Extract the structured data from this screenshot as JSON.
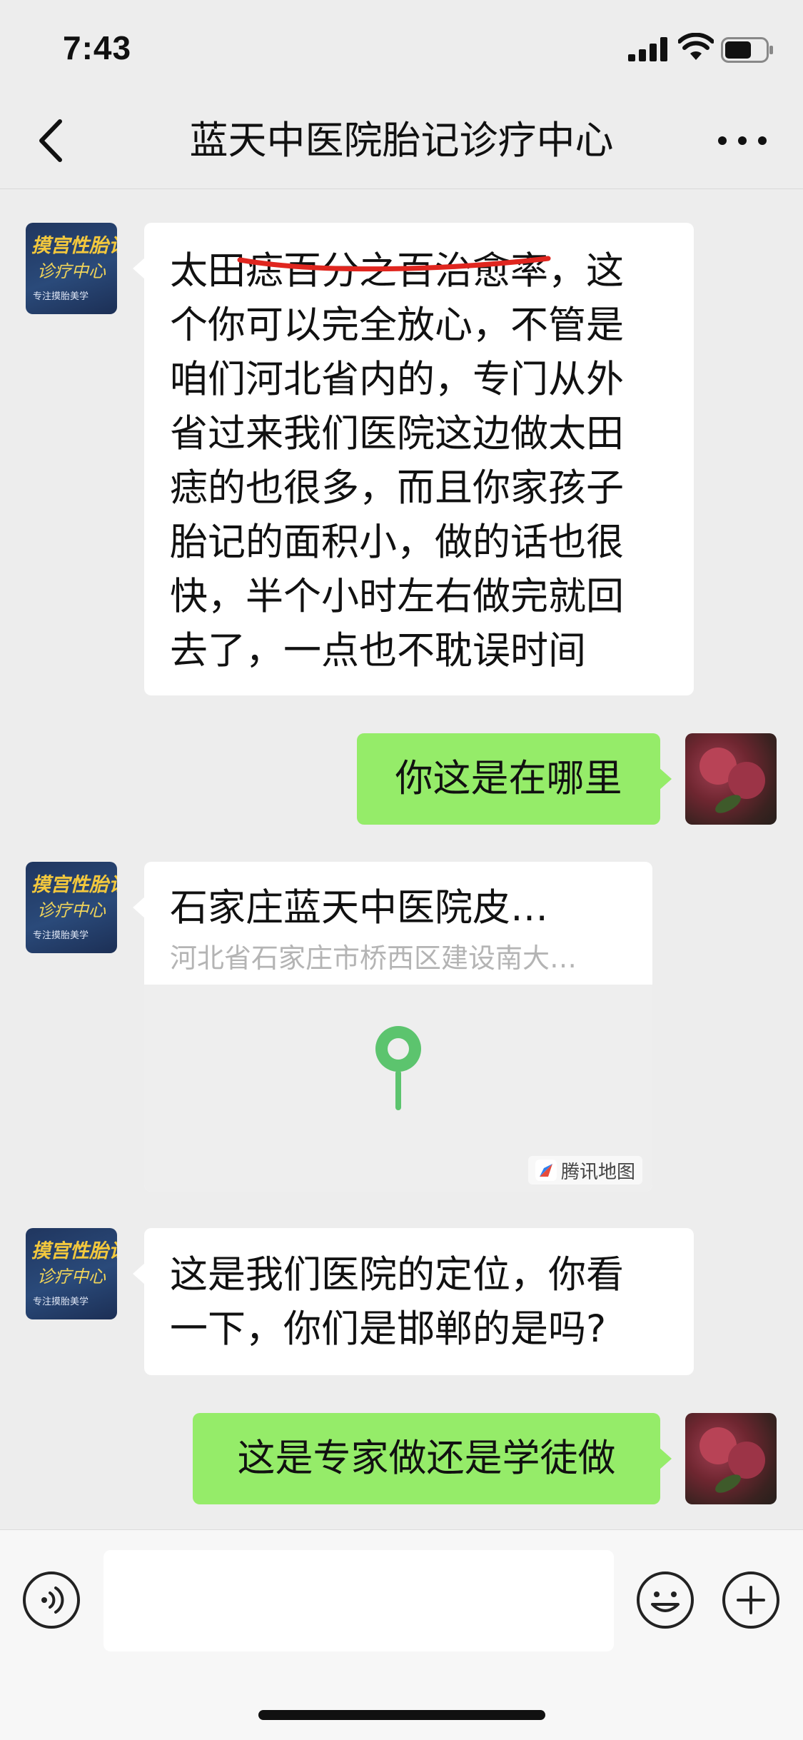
{
  "status_bar": {
    "time": "7:43"
  },
  "nav": {
    "title": "蓝天中医院胎记诊疗中心"
  },
  "contact_avatar": {
    "line1": "摸宫性胎记",
    "line2": "诊疗中心",
    "line3": "专注摸胎美学"
  },
  "messages": [
    {
      "sender": "contact",
      "type": "text",
      "text": "太田痣百分之百治愈率，这\n个你可以完全放心，不管是\n咱们河北省内的，专门从外\n省过来我们医院这边做太田\n痣的也很多，而且你家孩子\n胎记的面积小，做的话也很\n快，半个小时左右做完就回\n去了，一点也不耽误时间"
    },
    {
      "sender": "me",
      "type": "text",
      "text": "你这是在哪里"
    },
    {
      "sender": "contact",
      "type": "location",
      "name": "石家庄蓝天中医院皮…",
      "address": "河北省石家庄市桥西区建设南大…",
      "map_provider": "腾讯地图"
    },
    {
      "sender": "contact",
      "type": "text",
      "text": "这是我们医院的定位，你看\n一下，你们是邯郸的是吗?"
    },
    {
      "sender": "me",
      "type": "text",
      "text": "这是专家做还是学徒做"
    }
  ],
  "input_bar": {
    "placeholder": ""
  },
  "colors": {
    "background": "#ededed",
    "outgoing_bubble": "#95ec69",
    "incoming_bubble": "#ffffff",
    "map_pin": "#5cc46e",
    "annotation": "#e0261f"
  },
  "icons": [
    "signal-icon",
    "wifi-icon",
    "battery-icon",
    "back-icon",
    "more-icon",
    "voice-icon",
    "emoji-icon",
    "plus-icon",
    "map-pin-icon",
    "tencent-map-logo-icon"
  ]
}
